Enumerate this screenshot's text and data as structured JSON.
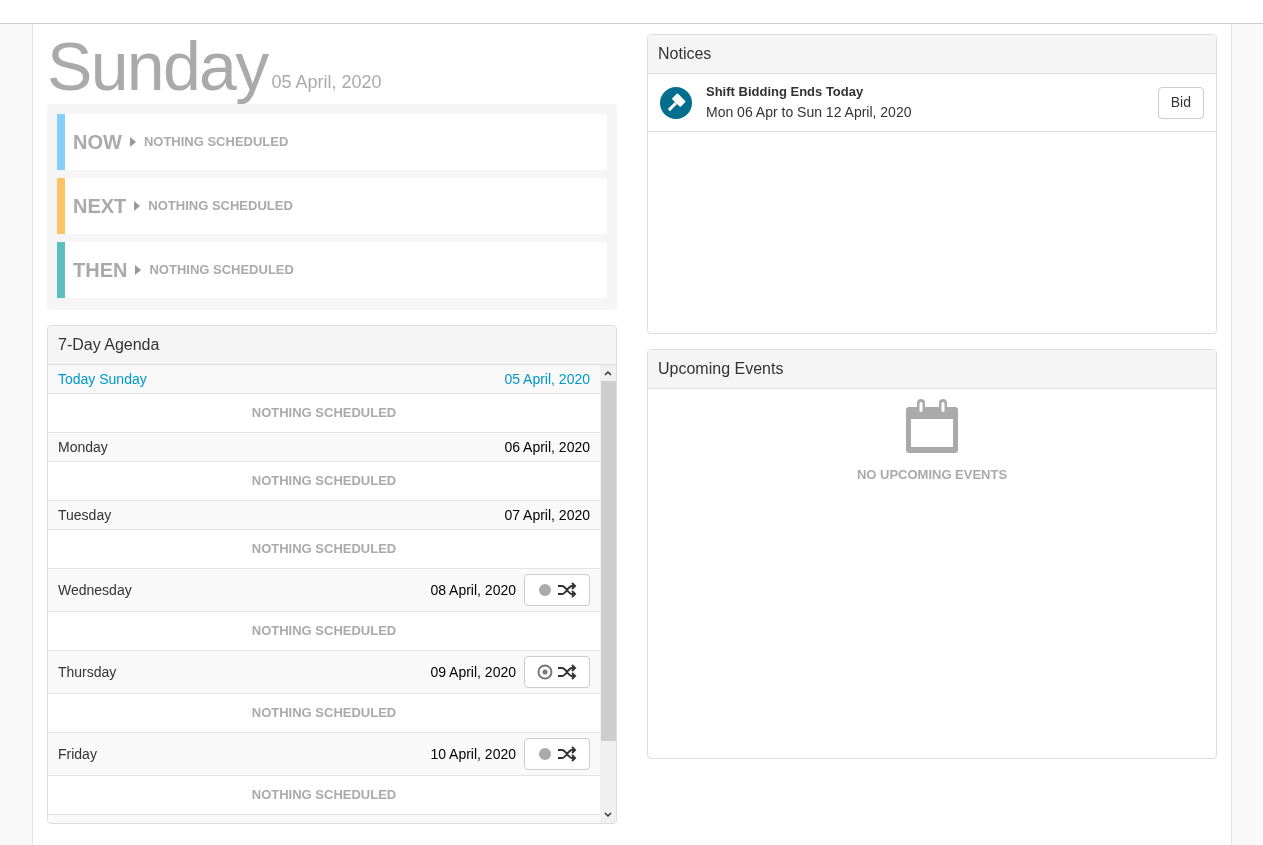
{
  "heading": {
    "day": "Sunday",
    "date": "05 April, 2020"
  },
  "now_next_then": [
    {
      "label": "NOW",
      "color": "#87cefa",
      "text": "NOTHING SCHEDULED"
    },
    {
      "label": "NEXT",
      "color": "#ffc266",
      "text": "NOTHING SCHEDULED"
    },
    {
      "label": "THEN",
      "color": "#5bbfbf",
      "text": "NOTHING SCHEDULED"
    }
  ],
  "agenda": {
    "title": "7-Day Agenda",
    "days": [
      {
        "day": "Today Sunday",
        "date": "05 April, 2020",
        "today": true,
        "items": [
          "NOTHING SCHEDULED"
        ]
      },
      {
        "day": "Monday",
        "date": "06 April, 2020",
        "today": false,
        "items": [
          "NOTHING SCHEDULED"
        ]
      },
      {
        "day": "Tuesday",
        "date": "07 April, 2020",
        "today": false,
        "items": [
          "NOTHING SCHEDULED"
        ]
      },
      {
        "day": "Wednesday",
        "date": "08 April, 2020",
        "today": false,
        "swap_toggle": {
          "selected": false
        },
        "items": [
          "NOTHING SCHEDULED"
        ]
      },
      {
        "day": "Thursday",
        "date": "09 April, 2020",
        "today": false,
        "swap_toggle": {
          "selected": true
        },
        "items": [
          "NOTHING SCHEDULED"
        ]
      },
      {
        "day": "Friday",
        "date": "10 April, 2020",
        "today": false,
        "swap_toggle": {
          "selected": false
        },
        "items": [
          "NOTHING SCHEDULED"
        ]
      }
    ]
  },
  "notices": {
    "title": "Notices",
    "items": [
      {
        "title": "Shift Bidding Ends Today",
        "subtitle": "Mon 06 Apr to Sun 12 April, 2020",
        "action": "Bid"
      }
    ]
  },
  "upcoming_events": {
    "title": "Upcoming Events",
    "empty_text": "NO UPCOMING EVENTS"
  }
}
